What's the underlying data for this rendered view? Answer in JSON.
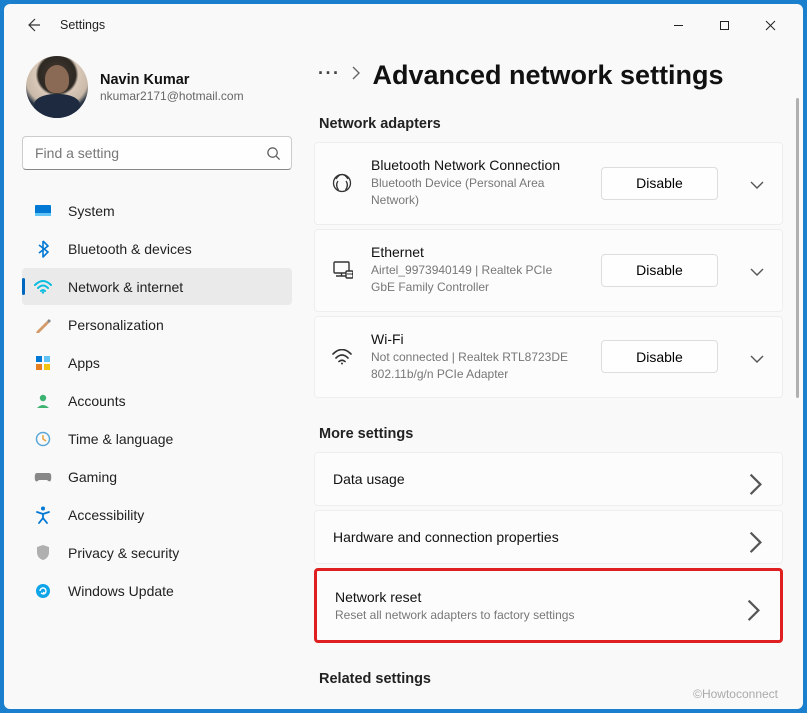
{
  "titlebar": {
    "title": "Settings"
  },
  "profile": {
    "name": "Navin Kumar",
    "email": "nkumar2171@hotmail.com"
  },
  "search": {
    "placeholder": "Find a setting"
  },
  "nav": {
    "items": [
      {
        "label": "System"
      },
      {
        "label": "Bluetooth & devices"
      },
      {
        "label": "Network & internet"
      },
      {
        "label": "Personalization"
      },
      {
        "label": "Apps"
      },
      {
        "label": "Accounts"
      },
      {
        "label": "Time & language"
      },
      {
        "label": "Gaming"
      },
      {
        "label": "Accessibility"
      },
      {
        "label": "Privacy & security"
      },
      {
        "label": "Windows Update"
      }
    ]
  },
  "page": {
    "title": "Advanced network settings"
  },
  "sections": {
    "adapters_head": "Network adapters",
    "more_head": "More settings",
    "related_head": "Related settings"
  },
  "adapters": [
    {
      "title": "Bluetooth Network Connection",
      "sub": "Bluetooth Device (Personal Area Network)",
      "btn": "Disable"
    },
    {
      "title": "Ethernet",
      "sub": "Airtel_9973940149 | Realtek PCIe GbE Family Controller",
      "btn": "Disable"
    },
    {
      "title": "Wi-Fi",
      "sub": "Not connected | Realtek RTL8723DE 802.11b/g/n PCIe Adapter",
      "btn": "Disable"
    }
  ],
  "more": [
    {
      "title": "Data usage",
      "sub": ""
    },
    {
      "title": "Hardware and connection properties",
      "sub": ""
    },
    {
      "title": "Network reset",
      "sub": "Reset all network adapters to factory settings"
    }
  ],
  "watermark": "©Howtoconnect"
}
